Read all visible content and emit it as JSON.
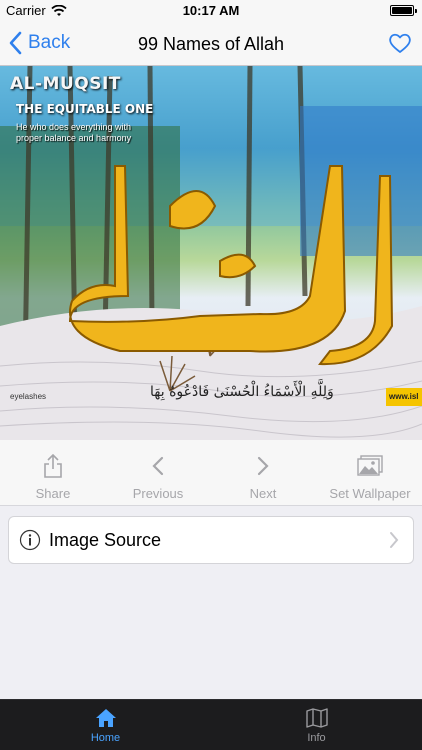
{
  "status_bar": {
    "carrier": "Carrier",
    "time": "10:17 AM"
  },
  "nav": {
    "back_label": "Back",
    "title": "99 Names of Allah"
  },
  "image": {
    "title": "AL-MUQSIT",
    "subtitle": "THE EQUITABLE ONE",
    "caption": "He who does everything with proper balance and harmony",
    "arabic_name": "المقسط",
    "arabic_verse": "وَلِلَّهِ الْأَسْمَاءُ الْحُسْنَىٰ فَادْعُوهُ بِهَا",
    "credit": "eyelashes",
    "website": "www.isl"
  },
  "toolbar": {
    "share_label": "Share",
    "previous_label": "Previous",
    "next_label": "Next",
    "wallpaper_label": "Set Wallpaper"
  },
  "source_row": {
    "label": "Image Source"
  },
  "tabs": [
    {
      "label": "Home",
      "active": true
    },
    {
      "label": "Info",
      "active": false
    }
  ],
  "colors": {
    "accent": "#2f80ed",
    "tab_active": "#4aa3ff",
    "tab_inactive": "#9a9a9e",
    "toolbar_disabled": "#a6a6aa"
  }
}
